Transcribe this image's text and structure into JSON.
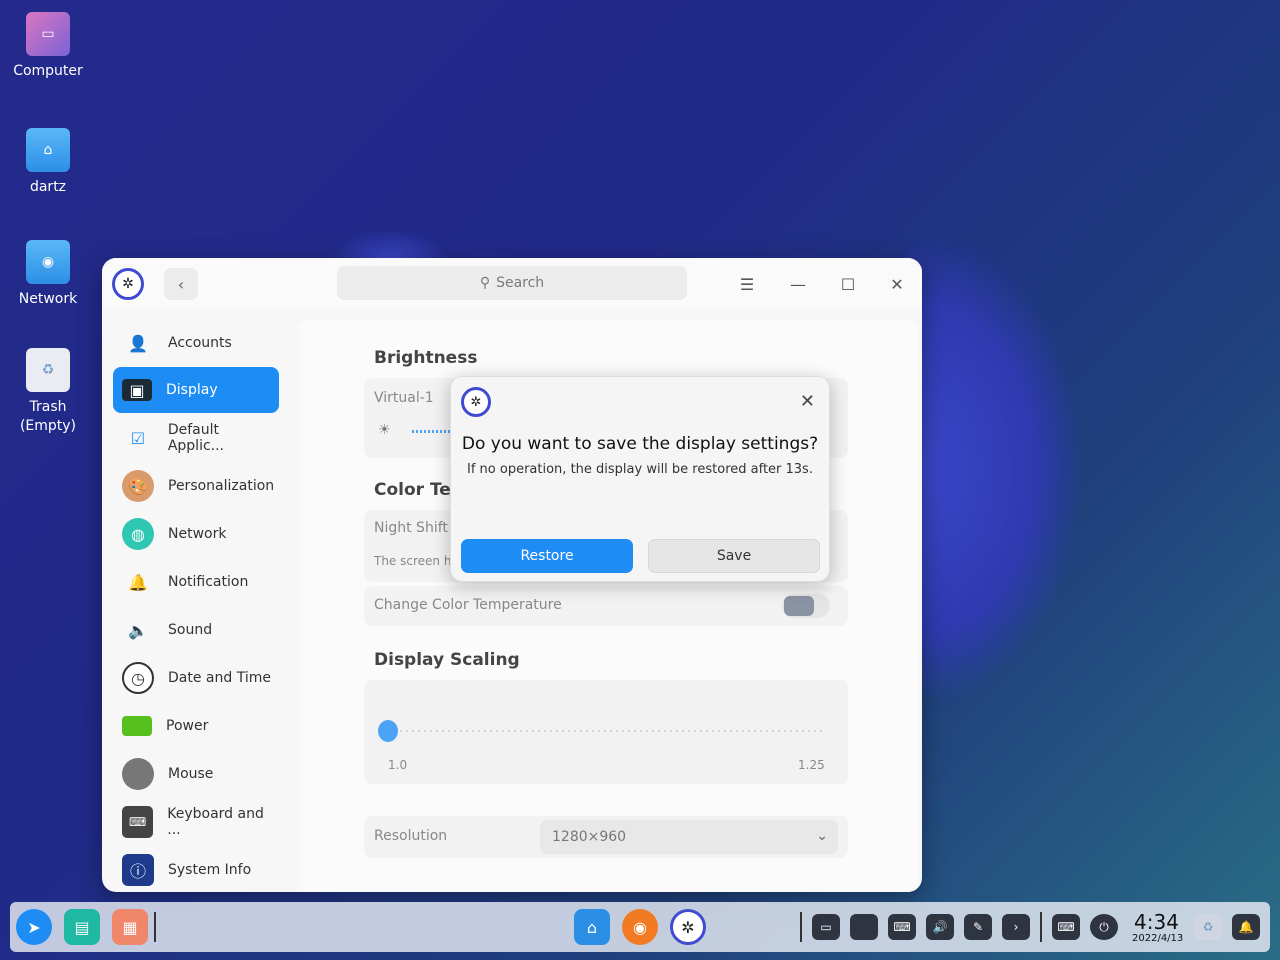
{
  "desktop": {
    "icons": [
      {
        "label": "Computer"
      },
      {
        "label": "dartz"
      },
      {
        "label": "Network"
      },
      {
        "label": "Trash\n(Empty)"
      }
    ]
  },
  "window": {
    "search_placeholder": "Search",
    "sidebar": {
      "items": [
        {
          "label": "Accounts",
          "icon": "user-icon",
          "active": false
        },
        {
          "label": "Display",
          "icon": "monitor-icon",
          "active": true
        },
        {
          "label": "Default Applic...",
          "icon": "default-apps-icon",
          "active": false
        },
        {
          "label": "Personalization",
          "icon": "palette-icon",
          "active": false
        },
        {
          "label": "Network",
          "icon": "globe-icon",
          "active": false
        },
        {
          "label": "Notification",
          "icon": "bell-icon",
          "active": false
        },
        {
          "label": "Sound",
          "icon": "speaker-icon",
          "active": false
        },
        {
          "label": "Date and Time",
          "icon": "clock-icon",
          "active": false
        },
        {
          "label": "Power",
          "icon": "battery-icon",
          "active": false
        },
        {
          "label": "Mouse",
          "icon": "mouse-icon",
          "active": false
        },
        {
          "label": "Keyboard and ...",
          "icon": "keyboard-icon",
          "active": false
        },
        {
          "label": "System Info",
          "icon": "info-icon",
          "active": false
        }
      ]
    },
    "content": {
      "brightness_title": "Brightness",
      "monitor_name": "Virtual-1",
      "color_temp_title": "Color Ten",
      "night_shift_label": "Night Shift",
      "night_shift_desc": "The screen h",
      "change_color_temp_label": "Change Color Temperature",
      "change_color_temp_enabled": false,
      "display_scaling_title": "Display Scaling",
      "scale_min_label": "1.0",
      "scale_max_label": "1.25",
      "scale_value": 1.0,
      "resolution_label": "Resolution",
      "resolution_value": "1280×960"
    }
  },
  "dialog": {
    "title": "Do you want to save the display settings?",
    "message": "If no operation, the display will be restored after 13s.",
    "restore_label": "Restore",
    "save_label": "Save"
  },
  "dock": {
    "time": "4:34",
    "date": "2022/4/13"
  },
  "colors": {
    "accent": "#1e8cf5",
    "brightness_slider": "#4aa3f5"
  }
}
